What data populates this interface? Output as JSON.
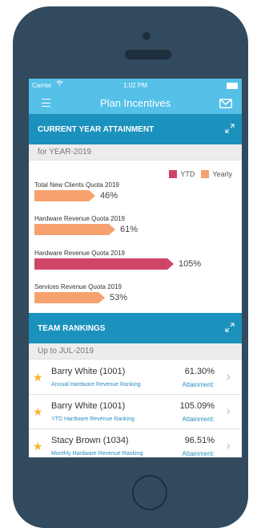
{
  "status_bar": {
    "carrier": "Carrier",
    "time": "1:02 PM"
  },
  "nav": {
    "title": "Plan Incentives",
    "menu_icon": "hamburger-menu-icon",
    "mail_icon": "mail-icon"
  },
  "attainment": {
    "header": "CURRENT YEAR ATTAINMENT",
    "period": "for YEAR-2019",
    "legend": {
      "ytd": "YTD",
      "yearly": "Yearly"
    },
    "colors": {
      "ytd": "#cf4565",
      "yearly": "#f7a26e"
    },
    "quotas": [
      {
        "label": "Total New Clients Quota 2019",
        "pct_label": "46%",
        "value": 46,
        "series": "yearly"
      },
      {
        "label": "Hardware Revenue Quota 2019",
        "pct_label": "61%",
        "value": 61,
        "series": "yearly"
      },
      {
        "label": "Hardware Revenue Quota 2019",
        "pct_label": "105%",
        "value": 105,
        "series": "ytd"
      },
      {
        "label": "Services Revenue Quota 2019",
        "pct_label": "53%",
        "value": 53,
        "series": "yearly"
      }
    ]
  },
  "rankings": {
    "header": "TEAM RANKINGS",
    "period": "Up to JUL-2019",
    "rows": [
      {
        "name": "Barry White (1001)",
        "subtitle": "Annual Hardware Revenue Ranking",
        "value": "61.30%",
        "attainment": "Attainment:"
      },
      {
        "name": "Barry White (1001)",
        "subtitle": "YTD Hardware Revenue Ranking",
        "value": "105.09%",
        "attainment": "Attainment:"
      },
      {
        "name": "Stacy Brown (1034)",
        "subtitle": "Monthly Hardware Revenue Ranking",
        "value": "96.51%",
        "attainment": "Attainment:"
      }
    ]
  }
}
